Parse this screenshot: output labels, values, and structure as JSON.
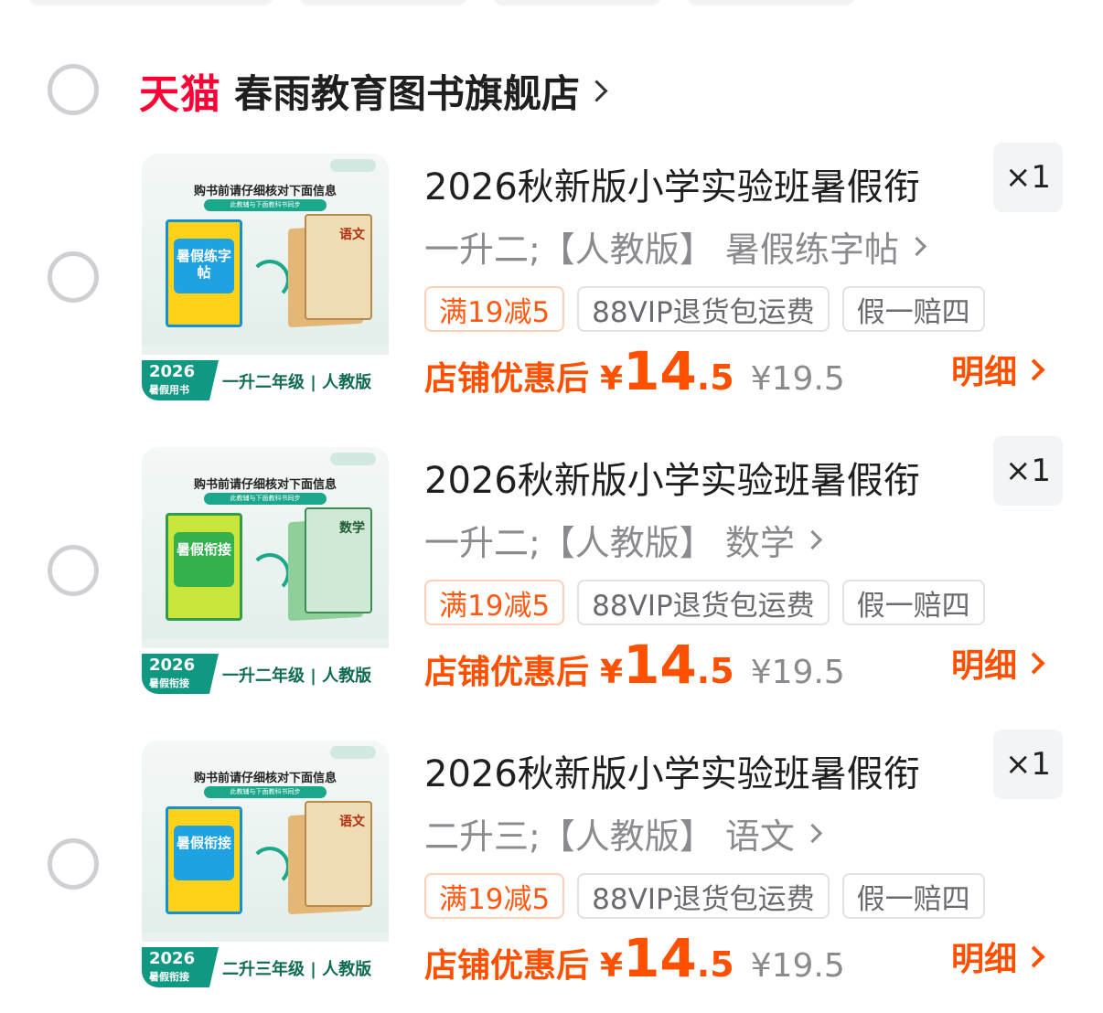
{
  "shop": {
    "platform_logo": "天猫",
    "name": "春雨教育图书旗舰店"
  },
  "items": [
    {
      "title": "2026秋新版小学实验班暑假衔",
      "quantity": "×1",
      "spec": "一升二;【人教版】 暑假练字帖",
      "tags": [
        "满19减5",
        "88VIP退货包运费",
        "假一赔四"
      ],
      "price_label": "店铺优惠后",
      "price_currency": "¥",
      "price_int": "14",
      "price_dec": ".5",
      "original_price": "¥19.5",
      "detail_label": "明细",
      "thumb": {
        "header": "购书前请仔细核对下面信息",
        "bar": "此教辅与下面教科书同步",
        "cover_text": "暑假练字帖",
        "textbook": "语文",
        "badge_year": "2026",
        "badge_sub": "暑假用书",
        "grade": "一升二年级 | 人教版"
      }
    },
    {
      "title": "2026秋新版小学实验班暑假衔",
      "quantity": "×1",
      "spec": "一升二;【人教版】 数学",
      "tags": [
        "满19减5",
        "88VIP退货包运费",
        "假一赔四"
      ],
      "price_label": "店铺优惠后",
      "price_currency": "¥",
      "price_int": "14",
      "price_dec": ".5",
      "original_price": "¥19.5",
      "detail_label": "明细",
      "thumb": {
        "header": "购书前请仔细核对下面信息",
        "bar": "此教辅与下面教科书同步",
        "cover_text": "暑假衔接",
        "textbook": "数学",
        "badge_year": "2026",
        "badge_sub": "暑假衔接",
        "grade": "一升二年级 | 人教版"
      }
    },
    {
      "title": "2026秋新版小学实验班暑假衔",
      "quantity": "×1",
      "spec": "二升三;【人教版】 语文",
      "tags": [
        "满19减5",
        "88VIP退货包运费",
        "假一赔四"
      ],
      "price_label": "店铺优惠后",
      "price_currency": "¥",
      "price_int": "14",
      "price_dec": ".5",
      "original_price": "¥19.5",
      "detail_label": "明细",
      "thumb": {
        "header": "购书前请仔细核对下面信息",
        "bar": "此教辅与下面教科书同步",
        "cover_text": "暑假衔接",
        "textbook": "语文",
        "badge_year": "2026",
        "badge_sub": "暑假衔接",
        "grade": "二升三年级 | 人教版"
      }
    }
  ],
  "colors": {
    "tmall_red": "#ff0036",
    "price_orange": "#ff5000",
    "radio_border": "#cfd0d4"
  }
}
